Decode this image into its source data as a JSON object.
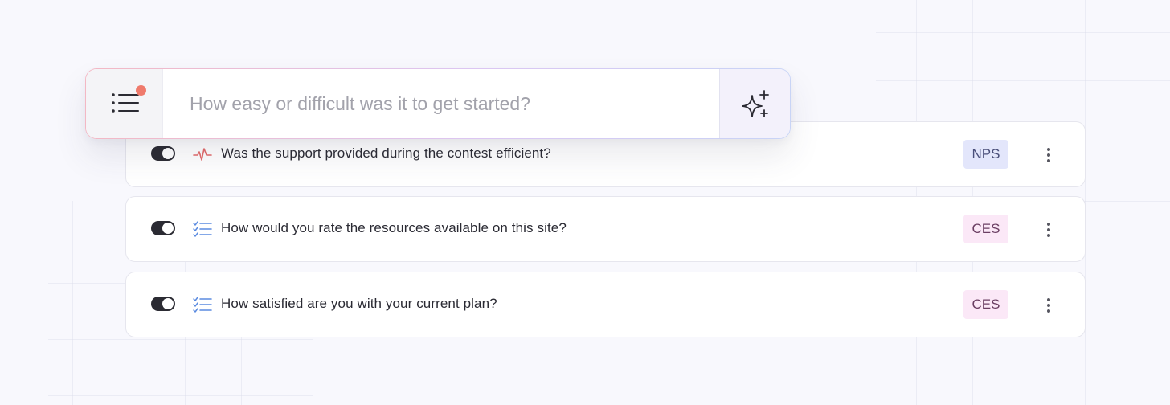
{
  "search": {
    "placeholder": "How easy or difficult was it to get started?",
    "value": ""
  },
  "icons": {
    "menu": "list-icon",
    "notification": "red-dot",
    "ai": "sparkles-icon",
    "pulse": "heartbeat-icon",
    "checklist": "checklist-icon",
    "more": "kebab-icon"
  },
  "colors": {
    "notification_dot": "#ef7a6c",
    "pulse_icon": "#e36b6b",
    "checklist_icon": "#5b8be0",
    "nps_badge_bg": "#e3e6fb",
    "ces_badge_bg": "#fbe8f7",
    "toggle_on": "#2b2b33"
  },
  "questions": [
    {
      "text": "Was the support provided during the contest efficient?",
      "type": "NPS",
      "enabled": true
    },
    {
      "text": "How would you rate the resources available on this site?",
      "type": "CES",
      "enabled": true
    },
    {
      "text": "How satisfied are you with your current plan?",
      "type": "CES",
      "enabled": true
    }
  ]
}
